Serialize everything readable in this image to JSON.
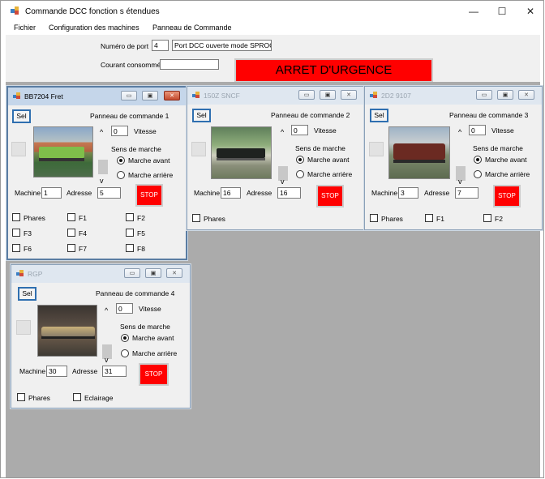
{
  "window": {
    "title": "Commande DCC fonction s étendues",
    "minimize_glyph": "—",
    "maximize_glyph": "☐",
    "close_glyph": "✕"
  },
  "menu": [
    "Fichier",
    "Configuration des machines",
    "Panneau de Commande"
  ],
  "header": {
    "port_label": "Numéro de port",
    "port_value": "4",
    "port_status": "Port DCC ouverte mode SPROG",
    "courant_label": "Courant consommé:",
    "courant_value": "",
    "emergency_label": "ARRET D'URGENCE"
  },
  "panels": [
    {
      "title": "BB7204 Fret",
      "sel": "Sel",
      "panneau": "Panneau de commande  1",
      "speed": "0",
      "vitesse": "Vitesse",
      "sens": "Sens de marche",
      "avant": "Marche avant",
      "arriere": "Marche arrière",
      "machine_label": "Machine",
      "machine": "1",
      "adresse_label": "Adresse",
      "adresse": "5",
      "stop": "STOP",
      "functions": [
        "Phares",
        "F1",
        "F2",
        "F3",
        "F4",
        "F5",
        "F6",
        "F7",
        "F8"
      ]
    },
    {
      "title": "150Z SNCF",
      "sel": "Sel",
      "panneau": "Panneau de commande  2",
      "speed": "0",
      "vitesse": "Vitesse",
      "sens": "Sens de marche",
      "avant": "Marche avant",
      "arriere": "Marche arrière",
      "machine_label": "Machine",
      "machine": "16",
      "adresse_label": "Adresse",
      "adresse": "16",
      "stop": "STOP",
      "functions": [
        "Phares"
      ]
    },
    {
      "title": "2D2 9107",
      "sel": "Sel",
      "panneau": "Panneau de commande  3",
      "speed": "0",
      "vitesse": "Vitesse",
      "sens": "Sens de marche",
      "avant": "Marche avant",
      "arriere": "Marche arrière",
      "machine_label": "Machine",
      "machine": "3",
      "adresse_label": "Adresse",
      "adresse": "7",
      "stop": "STOP",
      "functions": [
        "Phares",
        "F1",
        "F2"
      ]
    },
    {
      "title": "RGP",
      "sel": "Sel",
      "panneau": "Panneau de commande  4",
      "speed": "0",
      "vitesse": "Vitesse",
      "sens": "Sens de marche",
      "avant": "Marche avant",
      "arriere": "Marche arrière",
      "machine_label": "Machine",
      "machine": "30",
      "adresse_label": "Adresse",
      "adresse": "31",
      "stop": "STOP",
      "functions": [
        "Phares",
        "Eclairage"
      ]
    }
  ],
  "colors": {
    "emergency": "#ff0000",
    "stop": "#ff0000",
    "mdi_background": "#ababab",
    "active_border": "#5a7da3"
  }
}
